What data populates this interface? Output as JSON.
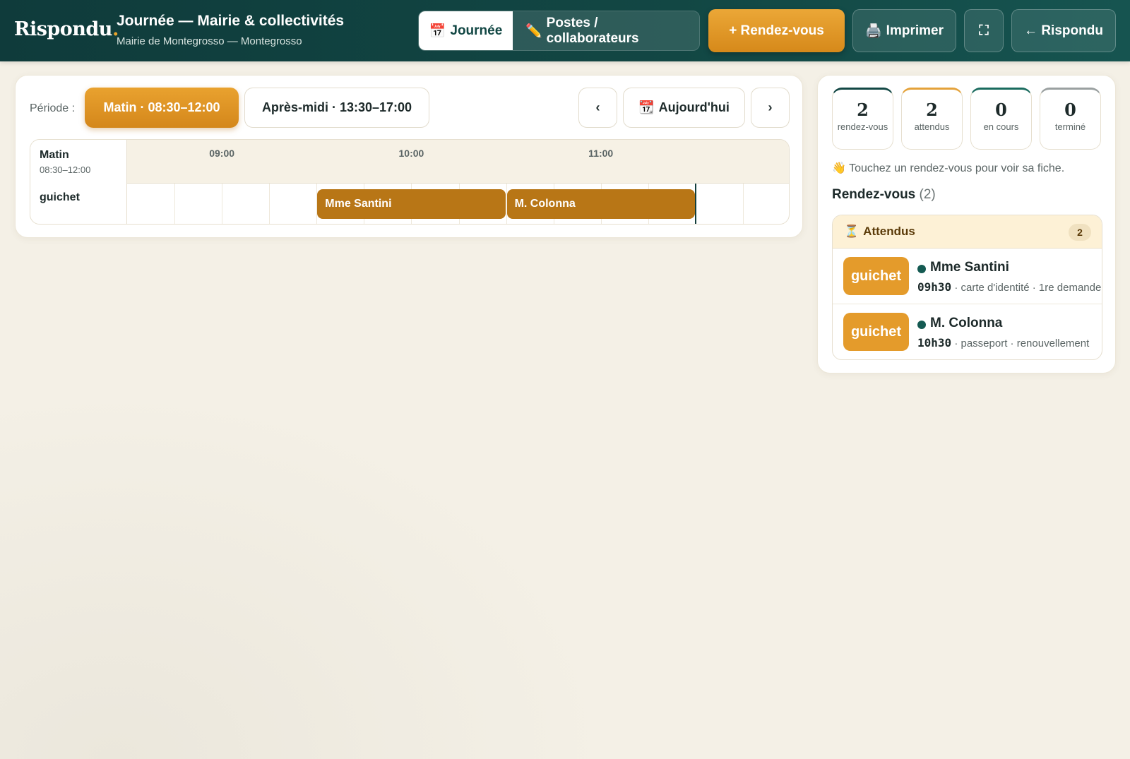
{
  "header": {
    "brand": "Rispondu",
    "brand_dot": ".",
    "title": "Journée — Mairie & collectivités",
    "subtitle": "Mairie de Montegrosso — Montegrosso",
    "tabs": [
      {
        "icon": "calendar-icon",
        "glyph": "📅",
        "label": "Journée",
        "active": true
      },
      {
        "icon": "pencil-icon",
        "glyph": "✏️",
        "label": "Postes / collaborateurs",
        "active": false
      }
    ],
    "new_appt_label": "+ Rendez-vous",
    "print_glyph": "🖨️",
    "print_label": "Imprimer",
    "fullscreen_glyph": "⛶",
    "back_label": "← Rispondu"
  },
  "period": {
    "label": "Période :",
    "options": [
      {
        "label": "Matin · 08:30–12:00",
        "active": true
      },
      {
        "label": "Après-midi · 13:30–17:00",
        "active": false
      }
    ],
    "prev_label": "‹",
    "today_glyph": "📆",
    "today_label": "Aujourd'hui",
    "next_label": "›"
  },
  "timeline": {
    "corner_title": "Matin",
    "corner_range": "08:30–12:00",
    "start": "08:30",
    "end": "12:00",
    "hours": [
      "09:00",
      "10:00",
      "11:00"
    ],
    "now": "11:30",
    "rows": [
      {
        "label": "guichet",
        "appointments": [
          {
            "name": "Mme Santini",
            "start": "09:30",
            "end": "10:30"
          },
          {
            "name": "M. Colonna",
            "start": "10:30",
            "end": "11:30"
          }
        ]
      }
    ]
  },
  "stats": [
    {
      "value": "2",
      "label": "rendez-vous",
      "color": "#124744"
    },
    {
      "value": "2",
      "label": "attendus",
      "color": "#e4a23a"
    },
    {
      "value": "0",
      "label": "en cours",
      "color": "#1a6b5e"
    },
    {
      "value": "0",
      "label": "terminé",
      "color": "#9aa0a0"
    }
  ],
  "hint": "👋 Touchez un rendez-vous pour voir sa fiche.",
  "list": {
    "title": "Rendez-vous",
    "count": "(2)",
    "group": {
      "icon": "hourglass-icon",
      "glyph": "⏳",
      "label": "Attendus",
      "count": "2",
      "items": [
        {
          "tag": "guichet",
          "name": "Mme Santini",
          "time": "09h30",
          "detail": " · carte d'identité · 1re demande"
        },
        {
          "tag": "guichet",
          "name": "M. Colonna",
          "time": "10h30",
          "detail": " · passeport · renouvellement"
        }
      ]
    }
  }
}
